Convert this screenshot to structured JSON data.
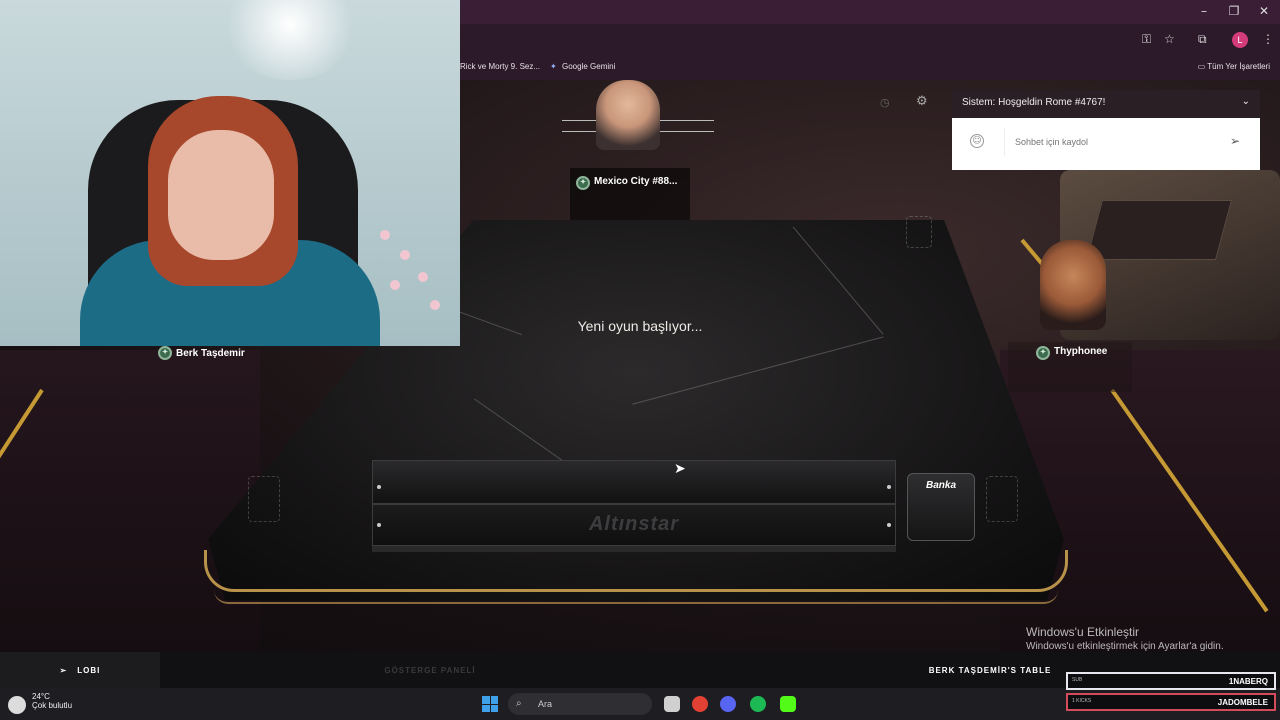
{
  "browser": {
    "bookmarks": [
      "Rick ve Morty 9. Sez...",
      "Google Gemini"
    ],
    "all_bookmarks": "Tüm Yer İşaretleri",
    "profile_initial": "L",
    "window_controls": {
      "minimize": "–",
      "restore": "❐",
      "close": "✕"
    }
  },
  "game": {
    "players": {
      "top": "Mexico City #88...",
      "left": "Berk Taşdemir",
      "right": "Thyphonee"
    },
    "status_message": "Yeni oyun başlıyor...",
    "rack_logo": "Altınstar",
    "bank_label": "Banka",
    "chat": {
      "system_message": "Sistem: Hoşgeldin Rome #4767!",
      "input_placeholder": "Sohbet için kaydol"
    },
    "nav": {
      "lobby": "LOBI",
      "dashboard": "GÖSTERGE PANELİ",
      "table_name": "BERK TAŞDEMİR'S TABLE"
    }
  },
  "windows_activation": {
    "title": "Windows'u Etkinleştir",
    "subtitle": "Windows'u etkinleştirmek için Ayarlar'a gidin."
  },
  "taskbar": {
    "weather_temp": "24°C",
    "weather_desc": "Çok bulutlu",
    "search_placeholder": "Ara"
  },
  "stream_alerts": [
    {
      "label": "SUB",
      "name": "1NABERQ"
    },
    {
      "label": "1 KICKS",
      "name": "JADOMBELE"
    }
  ],
  "colors": {
    "gold_accent": "#c59a34",
    "taskbar": "#1e1e22",
    "browser_chrome": "#2c1a2b"
  }
}
